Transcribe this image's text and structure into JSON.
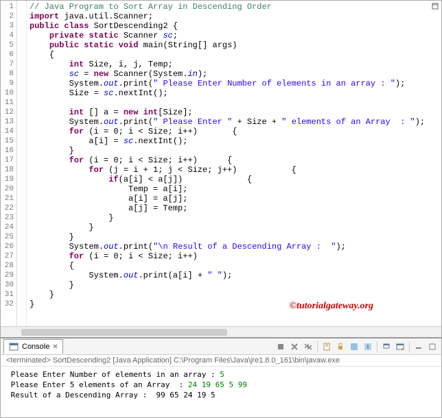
{
  "code": {
    "lines": [
      {
        "num": "1",
        "html": "<span class='comment'>// Java Program to Sort Array in Descending Order</span>"
      },
      {
        "num": "2",
        "html": "<span class='keyword'>import</span> java.util.Scanner;"
      },
      {
        "num": "3",
        "html": "<span class='keyword'>public</span> <span class='keyword'>class</span> SortDescending2 {"
      },
      {
        "num": "4",
        "html": "    <span class='keyword'>private</span> <span class='keyword'>static</span> Scanner <span class='static-field'>sc</span>;"
      },
      {
        "num": "5",
        "html": "    <span class='keyword'>public</span> <span class='keyword'>static</span> <span class='keyword'>void</span> main(String[] args)"
      },
      {
        "num": "6",
        "html": "    {"
      },
      {
        "num": "7",
        "html": "        <span class='keyword'>int</span> Size, i, j, Temp;"
      },
      {
        "num": "8",
        "html": "        <span class='static-field'>sc</span> = <span class='keyword'>new</span> Scanner(System.<span class='static-field'>in</span>);"
      },
      {
        "num": "9",
        "html": "        System.<span class='static-field'>out</span>.print(<span class='string'>\" Please Enter Number of elements in an array : \"</span>);"
      },
      {
        "num": "10",
        "html": "        Size = <span class='static-field'>sc</span>.nextInt();"
      },
      {
        "num": "11",
        "html": ""
      },
      {
        "num": "12",
        "html": "        <span class='keyword'>int</span> [] a = <span class='keyword'>new</span> <span class='keyword'>int</span>[Size];"
      },
      {
        "num": "13",
        "html": "        System.<span class='static-field'>out</span>.print(<span class='string'>\" Please Enter \"</span> + Size + <span class='string'>\" elements of an Array  : \"</span>);"
      },
      {
        "num": "14",
        "html": "        <span class='keyword'>for</span> (i = 0; i &lt; Size; i++)       {"
      },
      {
        "num": "15",
        "html": "            a[i] = <span class='static-field'>sc</span>.nextInt();"
      },
      {
        "num": "16",
        "html": "        }"
      },
      {
        "num": "17",
        "html": "        <span class='keyword'>for</span> (i = 0; i &lt; Size; i++)      {"
      },
      {
        "num": "18",
        "html": "            <span class='keyword'>for</span> (j = i + 1; j &lt; Size; j++)           {"
      },
      {
        "num": "19",
        "html": "                <span class='keyword'>if</span>(a[i] &lt; a[j])             {"
      },
      {
        "num": "20",
        "html": "                    Temp = a[i];"
      },
      {
        "num": "21",
        "html": "                    a[i] = a[j];"
      },
      {
        "num": "22",
        "html": "                    a[j] = Temp;"
      },
      {
        "num": "23",
        "html": "                }"
      },
      {
        "num": "24",
        "html": "            }"
      },
      {
        "num": "25",
        "html": "        }"
      },
      {
        "num": "26",
        "html": "        System.<span class='static-field'>out</span>.print(<span class='string'>\"\\n Result of a Descending Array :  \"</span>);"
      },
      {
        "num": "27",
        "html": "        <span class='keyword'>for</span> (i = 0; i &lt; Size; i++)"
      },
      {
        "num": "28",
        "html": "        {"
      },
      {
        "num": "29",
        "html": "            System.<span class='static-field'>out</span>.print(a[i] + <span class='string'>\" \"</span>);"
      },
      {
        "num": "30",
        "html": "        }"
      },
      {
        "num": "31",
        "html": "    }"
      },
      {
        "num": "32",
        "html": "}"
      }
    ]
  },
  "console": {
    "tab_label": "Console",
    "status": "<terminated> SortDescending2 [Java Application] C:\\Program Files\\Java\\jre1.8.0_161\\bin\\javaw.exe",
    "output": [
      {
        "prompt": " Please Enter Number of elements in an array : ",
        "input": "5"
      },
      {
        "prompt": " Please Enter 5 elements of an Array  : ",
        "input": "24 19 65 5 99"
      },
      {
        "prompt": "",
        "input": ""
      },
      {
        "prompt": " Result of a Descending Array :  99 65 24 19 5",
        "input": ""
      }
    ]
  },
  "watermark": "©tutorialgateway.org"
}
